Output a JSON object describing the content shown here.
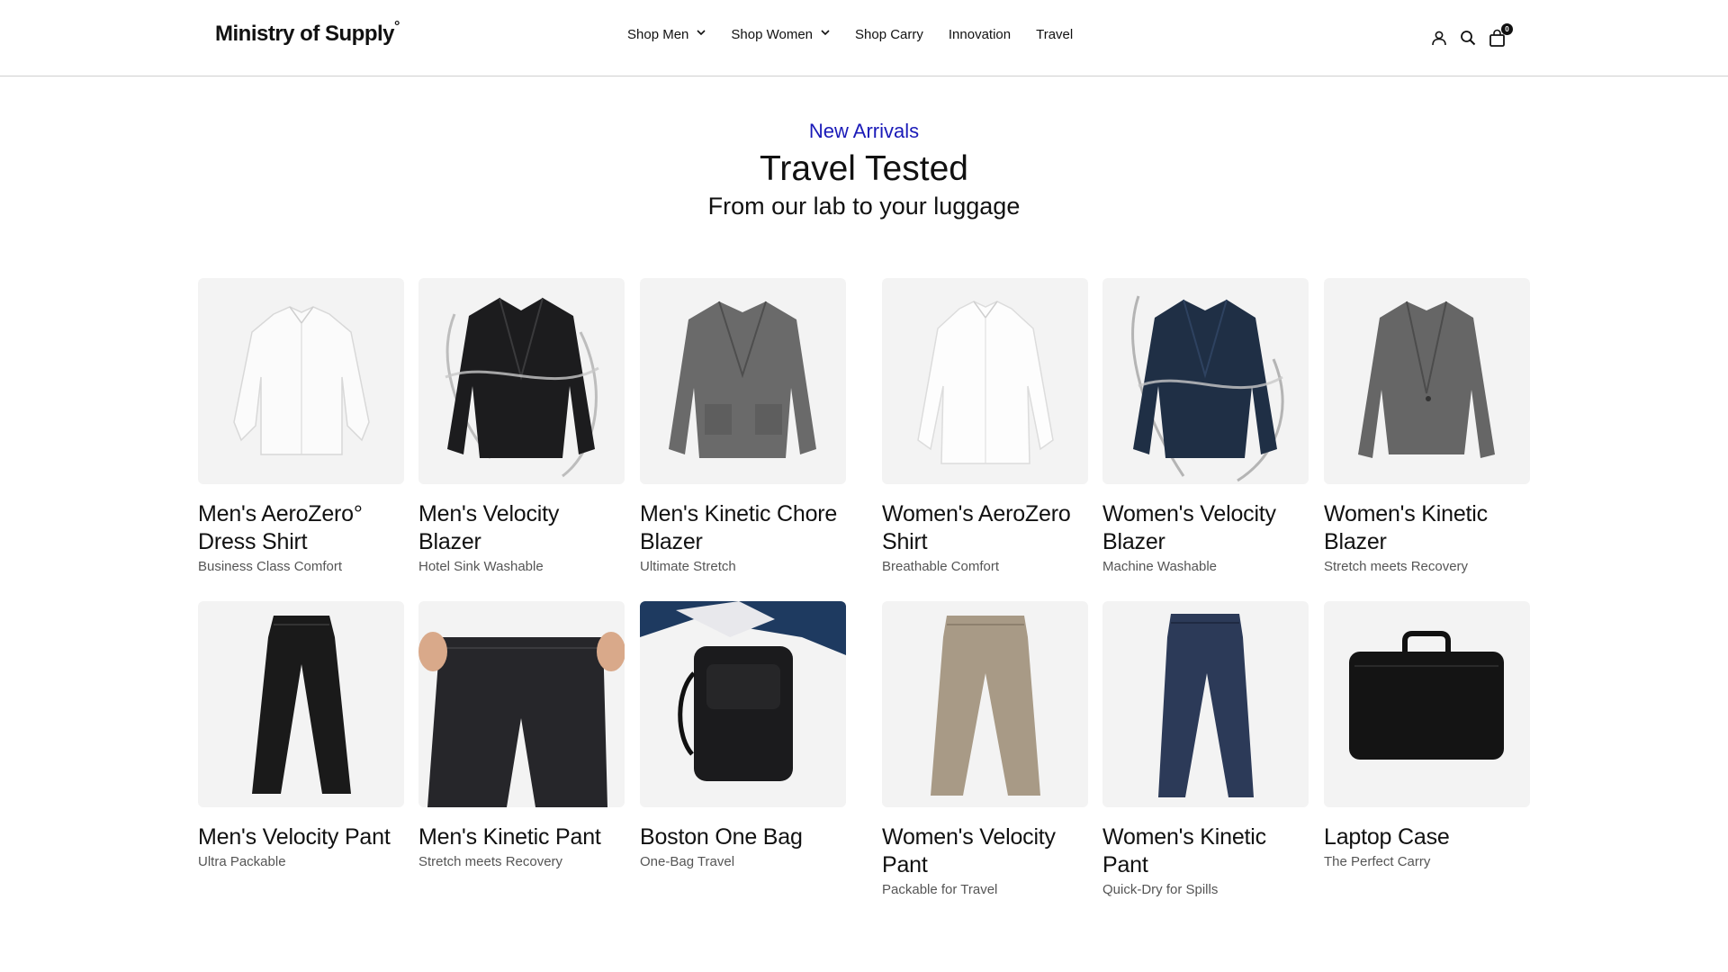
{
  "brand": {
    "name": "Ministry of Supply",
    "mark": "°"
  },
  "nav": {
    "items": [
      {
        "label": "Shop Men",
        "dropdown": true
      },
      {
        "label": "Shop Women",
        "dropdown": true
      },
      {
        "label": "Shop Carry",
        "dropdown": false
      },
      {
        "label": "Innovation",
        "dropdown": false
      },
      {
        "label": "Travel",
        "dropdown": false
      }
    ]
  },
  "header_icons": {
    "account": "user-icon",
    "search": "search-icon",
    "cart": "bag-icon",
    "cart_count": "0"
  },
  "hero": {
    "eyebrow": "New Arrivals",
    "title": "Travel Tested",
    "subtitle": "From our lab to your luggage"
  },
  "colors": {
    "accent": "#1a1ab8",
    "image_bg": "#f3f3f3"
  },
  "products": [
    {
      "name": "Men's AeroZero° Dress Shirt",
      "tagline": "Business Class Comfort",
      "image": "white dress shirt"
    },
    {
      "name": "Men's Velocity Blazer",
      "tagline": "Hotel Sink Washable",
      "image": "black blazer with water splash"
    },
    {
      "name": "Men's Kinetic Chore Blazer",
      "tagline": "Ultimate Stretch",
      "image": "grey chore blazer"
    },
    {
      "name": "Women's AeroZero Shirt",
      "tagline": "Breathable Comfort",
      "image": "white shirt"
    },
    {
      "name": "Women's Velocity Blazer",
      "tagline": "Machine Washable",
      "image": "navy blazer with water splash"
    },
    {
      "name": "Women's Kinetic Blazer",
      "tagline": "Stretch meets Recovery",
      "image": "grey blazer"
    },
    {
      "name": "Men's Velocity Pant",
      "tagline": "Ultra Packable",
      "image": "black pant"
    },
    {
      "name": "Men's Kinetic Pant",
      "tagline": "Stretch meets Recovery",
      "image": "charcoal pant being stretched"
    },
    {
      "name": "Boston One Bag",
      "tagline": "One-Bag Travel",
      "image": "black backpack"
    },
    {
      "name": "Women's Velocity Pant",
      "tagline": "Packable for Travel",
      "image": "tan wide-leg pant"
    },
    {
      "name": "Women's Kinetic Pant",
      "tagline": "Quick-Dry for Spills",
      "image": "navy pant"
    },
    {
      "name": "Laptop Case",
      "tagline": "The Perfect Carry",
      "image": "black laptop case"
    }
  ]
}
